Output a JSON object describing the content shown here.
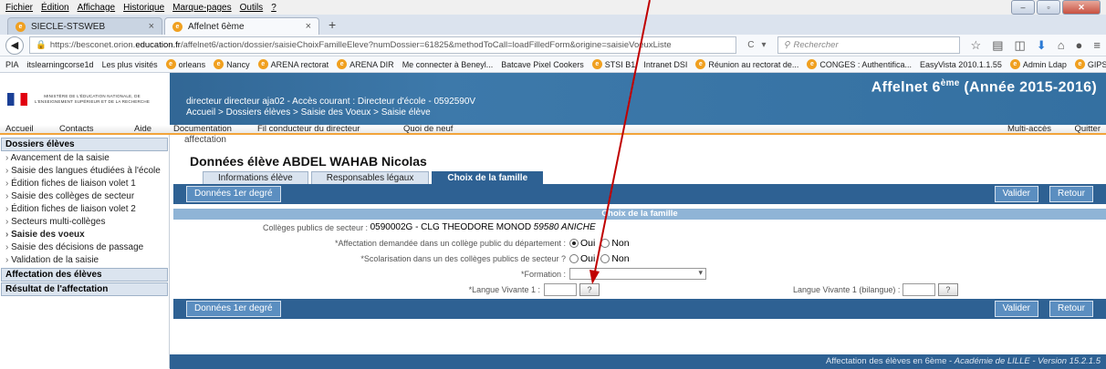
{
  "browser": {
    "menu": [
      "Fichier",
      "Édition",
      "Affichage",
      "Historique",
      "Marque-pages",
      "Outils",
      "?"
    ],
    "tabs": [
      {
        "title": "SIECLE-STSWEB",
        "active": false
      },
      {
        "title": "Affelnet 6ème",
        "active": true
      }
    ],
    "url_prefix": "https://besconet.orion.",
    "url_domain": "education.fr",
    "url_suffix": "/affelnet6/action/dossier/saisieChoixFamilleEleve?numDossier=61825&methodToCall=loadFilledForm&origine=saisieVoeuxListe",
    "search_placeholder": "Rechercher",
    "bookmarks": [
      "PIA",
      "itslearningcorse1d",
      "Les plus visités",
      "orleans",
      "Nancy",
      "ARENA rectorat",
      "ARENA DIR",
      "Me connecter à Beneyl...",
      "Batcave Pixel Cookers",
      "STSI B1",
      "Intranet DSI",
      "Réunion au rectorat de...",
      "CONGES : Authentifica...",
      "EasyVista 2010.1.1.55",
      "Admin Ldap",
      "GIPSCI",
      "»"
    ]
  },
  "header": {
    "ministry": "MINISTÈRE DE L'ÉDUCATION NATIONALE, DE L'ENSEIGNEMENT SUPÉRIEUR ET DE LA RECHERCHE",
    "user_line": "directeur directeur aja02 - Accès courant : Directeur d'école - 0592590V",
    "breadcrumb": "Accueil > Dossiers élèves > Saisie des Voeux > Saisie élève",
    "app_title": "Affelnet 6",
    "app_title_sup": "ème",
    "app_title_year": " (Année 2015-2016)"
  },
  "appnav": {
    "accueil": "Accueil",
    "contacts": "Contacts",
    "aide": "Aide",
    "documentation": "Documentation",
    "fil": "Fil conducteur du directeur",
    "quoi": "Quoi de neuf",
    "multi": "Multi-accès",
    "quitter": "Quitter"
  },
  "sidebar": {
    "section1": "Dossiers élèves",
    "items": [
      "Avancement de la saisie",
      "Saisie des langues étudiées à l'école",
      "Édition fiches de liaison volet 1",
      "Saisie des collèges de secteur",
      "Édition fiches de liaison volet 2",
      "Secteurs multi-collèges",
      "Saisie des voeux",
      "Saisie des décisions de passage",
      "Validation de la saisie"
    ],
    "section2": "Affectation des élèves",
    "section3": "Résultat de l'affectation"
  },
  "content": {
    "crumb": "affectation",
    "title": "Données élève ABDEL WAHAB Nicolas",
    "tabs": [
      "Informations élève",
      "Responsables légaux",
      "Choix de la famille"
    ],
    "btn_donnees": "Données 1er degré",
    "btn_valider": "Valider",
    "btn_retour": "Retour",
    "section_title": "Choix de la famille",
    "college_label": "Collèges publics de secteur :",
    "college_value": "0590002G - CLG THEODORE MONOD",
    "college_city": "59580 ANICHE",
    "affect_label": "*Affectation demandée dans un collège public du département :",
    "scol_label": "*Scolarisation dans un des collèges publics de secteur ?",
    "formation_label": "*Formation :",
    "lv1_label": "*Langue Vivante 1 :",
    "lv1_bil_label": "Langue Vivante 1 (bilangue) :",
    "oui": "Oui",
    "non": "Non",
    "qmark": "?"
  },
  "footer": {
    "text": "Affectation des élèves en 6ème - ",
    "italic": "Académie de LILLE - Version 15.2.1.5"
  },
  "colors": {
    "header_blue": "#2e6193",
    "accent_orange": "#f2a43a",
    "arrow": "#c00000"
  }
}
